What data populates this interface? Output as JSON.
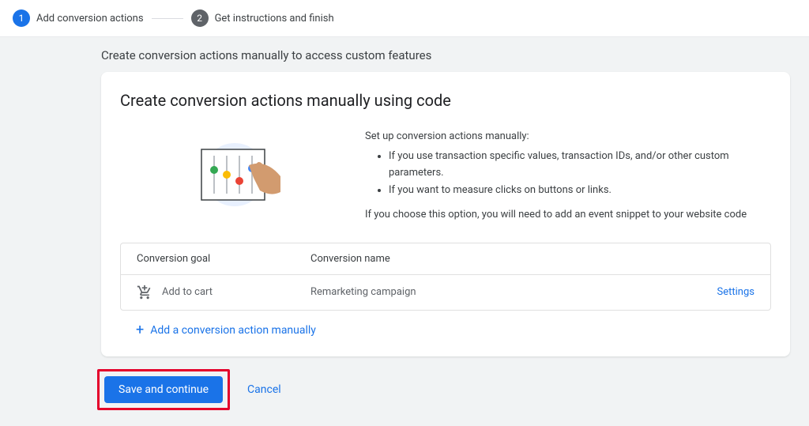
{
  "stepper": {
    "steps": [
      {
        "num": "1",
        "label": "Add conversion actions"
      },
      {
        "num": "2",
        "label": "Get instructions and finish"
      }
    ]
  },
  "subtitle": "Create conversion actions manually to access custom features",
  "card": {
    "title": "Create conversion actions manually using code",
    "intro_lead": "Set up conversion actions manually:",
    "bullets": [
      "If you use transaction specific values, transaction IDs, and/or other custom parameters.",
      "If you want to measure clicks on buttons or links."
    ],
    "intro_note": "If you choose this option, you will need to add an event snippet to your website code"
  },
  "table": {
    "headers": {
      "goal": "Conversion goal",
      "name": "Conversion name"
    },
    "rows": [
      {
        "goal": "Add to cart",
        "name": "Remarketing campaign",
        "action": "Settings"
      }
    ]
  },
  "add_action": "Add a conversion action manually",
  "footer": {
    "save": "Save and continue",
    "cancel": "Cancel"
  }
}
